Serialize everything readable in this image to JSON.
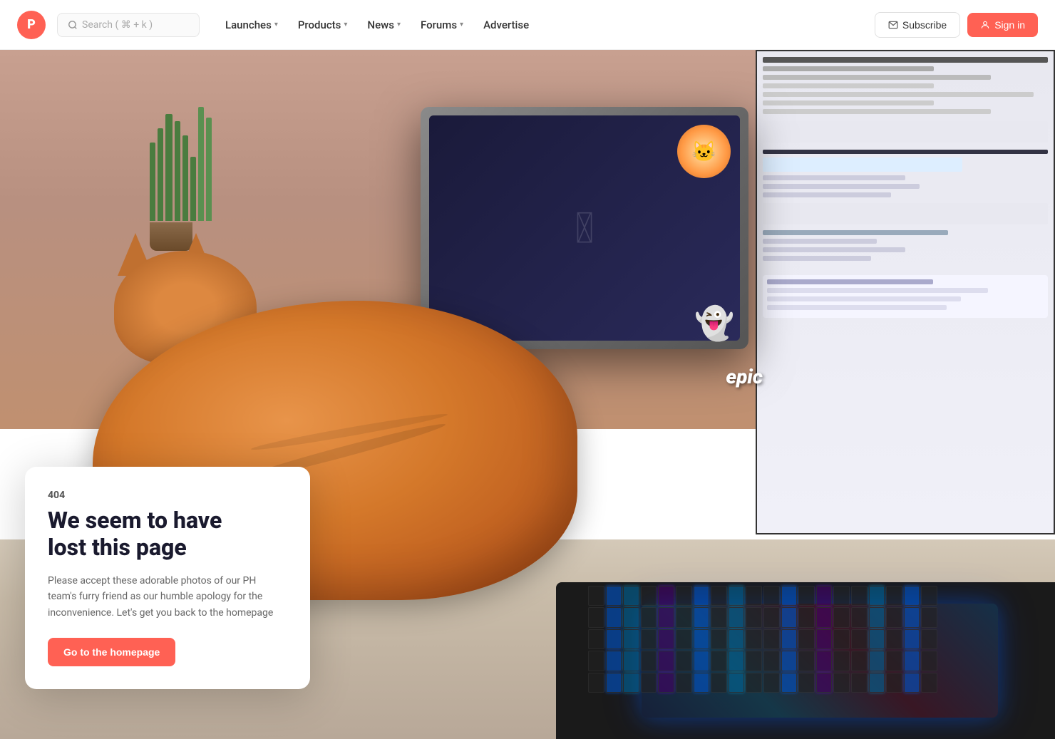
{
  "site": {
    "logo_letter": "P",
    "logo_bg": "#ff6154"
  },
  "navbar": {
    "search_placeholder": "Search ( ⌘ + k )",
    "nav_items": [
      {
        "id": "launches",
        "label": "Launches",
        "has_dropdown": true
      },
      {
        "id": "products",
        "label": "Products",
        "has_dropdown": true
      },
      {
        "id": "news",
        "label": "News",
        "has_dropdown": true
      },
      {
        "id": "forums",
        "label": "Forums",
        "has_dropdown": true
      },
      {
        "id": "advertise",
        "label": "Advertise",
        "has_dropdown": false
      }
    ],
    "subscribe_label": "Subscribe",
    "signin_label": "Sign in"
  },
  "error_page": {
    "code": "404",
    "title_line1": "We seem to have",
    "title_line2": "lost this page",
    "description": "Please accept these adorable photos of our PH team's furry friend as our humble apology for the inconvenience. Let's get you back to the homepage",
    "cta_label": "Go to the homepage"
  }
}
